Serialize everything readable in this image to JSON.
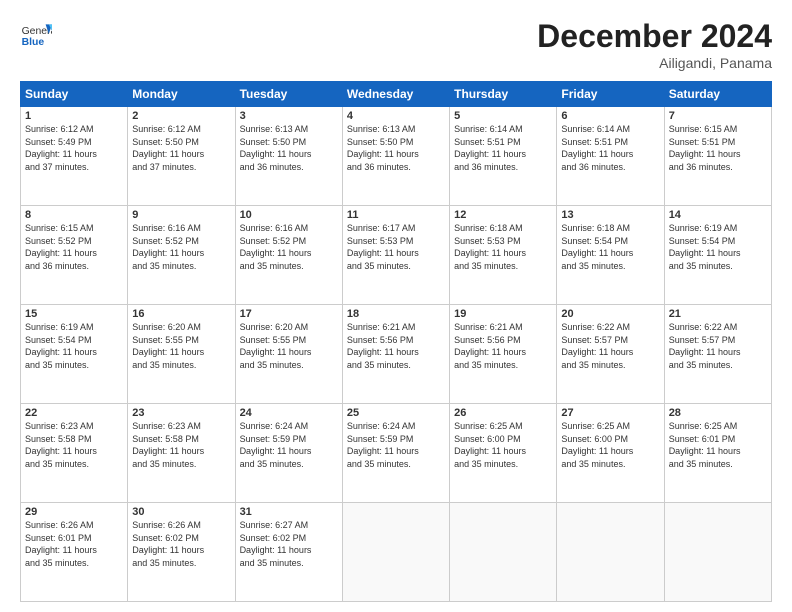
{
  "logo": {
    "general": "General",
    "blue": "Blue"
  },
  "header": {
    "month": "December 2024",
    "location": "Ailigandi, Panama"
  },
  "weekdays": [
    "Sunday",
    "Monday",
    "Tuesday",
    "Wednesday",
    "Thursday",
    "Friday",
    "Saturday"
  ],
  "weeks": [
    [
      {
        "day": "1",
        "sunrise": "6:12 AM",
        "sunset": "5:49 PM",
        "daylight": "11 hours and 37 minutes."
      },
      {
        "day": "2",
        "sunrise": "6:12 AM",
        "sunset": "5:50 PM",
        "daylight": "11 hours and 37 minutes."
      },
      {
        "day": "3",
        "sunrise": "6:13 AM",
        "sunset": "5:50 PM",
        "daylight": "11 hours and 36 minutes."
      },
      {
        "day": "4",
        "sunrise": "6:13 AM",
        "sunset": "5:50 PM",
        "daylight": "11 hours and 36 minutes."
      },
      {
        "day": "5",
        "sunrise": "6:14 AM",
        "sunset": "5:51 PM",
        "daylight": "11 hours and 36 minutes."
      },
      {
        "day": "6",
        "sunrise": "6:14 AM",
        "sunset": "5:51 PM",
        "daylight": "11 hours and 36 minutes."
      },
      {
        "day": "7",
        "sunrise": "6:15 AM",
        "sunset": "5:51 PM",
        "daylight": "11 hours and 36 minutes."
      }
    ],
    [
      {
        "day": "8",
        "sunrise": "6:15 AM",
        "sunset": "5:52 PM",
        "daylight": "11 hours and 36 minutes."
      },
      {
        "day": "9",
        "sunrise": "6:16 AM",
        "sunset": "5:52 PM",
        "daylight": "11 hours and 35 minutes."
      },
      {
        "day": "10",
        "sunrise": "6:16 AM",
        "sunset": "5:52 PM",
        "daylight": "11 hours and 35 minutes."
      },
      {
        "day": "11",
        "sunrise": "6:17 AM",
        "sunset": "5:53 PM",
        "daylight": "11 hours and 35 minutes."
      },
      {
        "day": "12",
        "sunrise": "6:18 AM",
        "sunset": "5:53 PM",
        "daylight": "11 hours and 35 minutes."
      },
      {
        "day": "13",
        "sunrise": "6:18 AM",
        "sunset": "5:54 PM",
        "daylight": "11 hours and 35 minutes."
      },
      {
        "day": "14",
        "sunrise": "6:19 AM",
        "sunset": "5:54 PM",
        "daylight": "11 hours and 35 minutes."
      }
    ],
    [
      {
        "day": "15",
        "sunrise": "6:19 AM",
        "sunset": "5:54 PM",
        "daylight": "11 hours and 35 minutes."
      },
      {
        "day": "16",
        "sunrise": "6:20 AM",
        "sunset": "5:55 PM",
        "daylight": "11 hours and 35 minutes."
      },
      {
        "day": "17",
        "sunrise": "6:20 AM",
        "sunset": "5:55 PM",
        "daylight": "11 hours and 35 minutes."
      },
      {
        "day": "18",
        "sunrise": "6:21 AM",
        "sunset": "5:56 PM",
        "daylight": "11 hours and 35 minutes."
      },
      {
        "day": "19",
        "sunrise": "6:21 AM",
        "sunset": "5:56 PM",
        "daylight": "11 hours and 35 minutes."
      },
      {
        "day": "20",
        "sunrise": "6:22 AM",
        "sunset": "5:57 PM",
        "daylight": "11 hours and 35 minutes."
      },
      {
        "day": "21",
        "sunrise": "6:22 AM",
        "sunset": "5:57 PM",
        "daylight": "11 hours and 35 minutes."
      }
    ],
    [
      {
        "day": "22",
        "sunrise": "6:23 AM",
        "sunset": "5:58 PM",
        "daylight": "11 hours and 35 minutes."
      },
      {
        "day": "23",
        "sunrise": "6:23 AM",
        "sunset": "5:58 PM",
        "daylight": "11 hours and 35 minutes."
      },
      {
        "day": "24",
        "sunrise": "6:24 AM",
        "sunset": "5:59 PM",
        "daylight": "11 hours and 35 minutes."
      },
      {
        "day": "25",
        "sunrise": "6:24 AM",
        "sunset": "5:59 PM",
        "daylight": "11 hours and 35 minutes."
      },
      {
        "day": "26",
        "sunrise": "6:25 AM",
        "sunset": "6:00 PM",
        "daylight": "11 hours and 35 minutes."
      },
      {
        "day": "27",
        "sunrise": "6:25 AM",
        "sunset": "6:00 PM",
        "daylight": "11 hours and 35 minutes."
      },
      {
        "day": "28",
        "sunrise": "6:25 AM",
        "sunset": "6:01 PM",
        "daylight": "11 hours and 35 minutes."
      }
    ],
    [
      {
        "day": "29",
        "sunrise": "6:26 AM",
        "sunset": "6:01 PM",
        "daylight": "11 hours and 35 minutes."
      },
      {
        "day": "30",
        "sunrise": "6:26 AM",
        "sunset": "6:02 PM",
        "daylight": "11 hours and 35 minutes."
      },
      {
        "day": "31",
        "sunrise": "6:27 AM",
        "sunset": "6:02 PM",
        "daylight": "11 hours and 35 minutes."
      },
      null,
      null,
      null,
      null
    ]
  ]
}
